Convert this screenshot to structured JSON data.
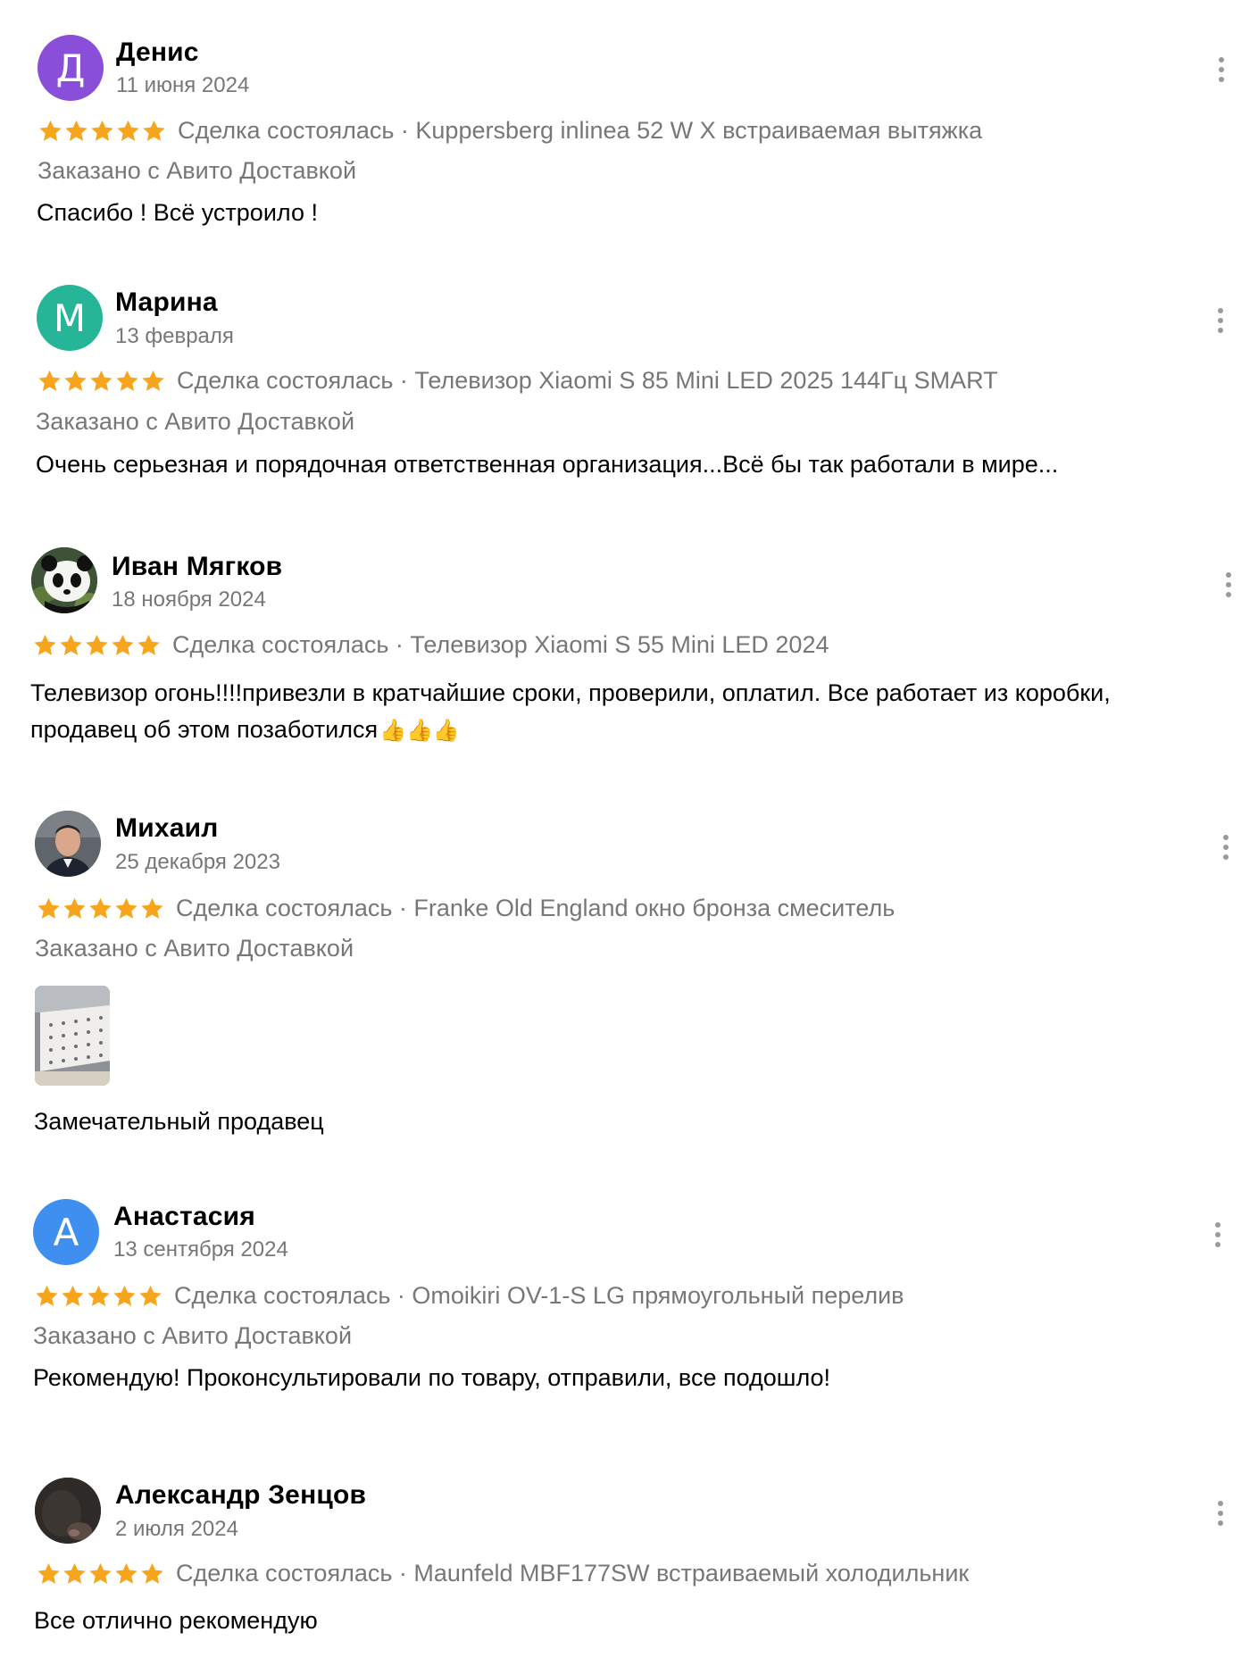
{
  "reviews": [
    {
      "author": "Денис",
      "avatar_letter": "Д",
      "avatar_color": "#8a4fd8",
      "date": "11 июня 2024",
      "rating": 5,
      "deal": "Сделка состоялась · Kuppersberg inlinea 52 W X встраиваемая вытяжка",
      "delivery": "Заказано с Авито Доставкой",
      "text": "Спасибо ! Всё устроило !"
    },
    {
      "author": "Марина",
      "avatar_letter": "М",
      "avatar_color": "#26b596",
      "date": "13 февраля",
      "rating": 5,
      "deal": "Сделка состоялась · Телевизор Xiaomi S 85 Mini LED 2025 144Гц SMART",
      "delivery": "Заказано с Авито Доставкой",
      "text": "Очень серьезная и порядочная ответственная организация...Всё бы так работали в мире..."
    },
    {
      "author": "Иван Мягков",
      "avatar_image": "panda-photo",
      "date": "18 ноября 2024",
      "rating": 5,
      "deal": "Сделка состоялась · Телевизор Xiaomi S 55 Mini LED 2024",
      "text_line1": "Телевизор огонь!!!!привезли в кратчайшие сроки, проверили, оплатил. Все работает из коробки,",
      "text_line2": "продавец об этом позаботился",
      "emoji": "👍👍👍"
    },
    {
      "author": "Михаил",
      "avatar_image": "man-photo",
      "date": "25 декабря 2023",
      "rating": 5,
      "deal": "Сделка состоялась · Franke Old England окно бронза смеситель",
      "delivery": "Заказано с Авито Доставкой",
      "attachment": "product-photo",
      "text": "Замечательный продавец"
    },
    {
      "author": "Анастасия",
      "avatar_letter": "А",
      "avatar_color": "#3f8ff0",
      "date": "13 сентября 2024",
      "rating": 5,
      "deal": "Сделка состоялась · Omoikiri OV-1-S LG прямоугольный перелив",
      "delivery": "Заказано с Авито Доставкой",
      "text": "Рекомендую! Проконсультировали по товару, отправили, все подошло!"
    },
    {
      "author": "Александр Зенцов",
      "avatar_image": "dark-photo",
      "date": "2 июля 2024",
      "rating": 5,
      "deal": "Сделка состоялась · Maunfeld MBF177SW встраиваемый холодильник",
      "text": "Все отлично рекомендую"
    }
  ],
  "colors": {
    "star": "#f7a51c",
    "muted": "#777777",
    "more_dots": "#9a9a9a"
  },
  "icons": {
    "rating": "star-icon",
    "menu": "more-vertical-icon"
  }
}
